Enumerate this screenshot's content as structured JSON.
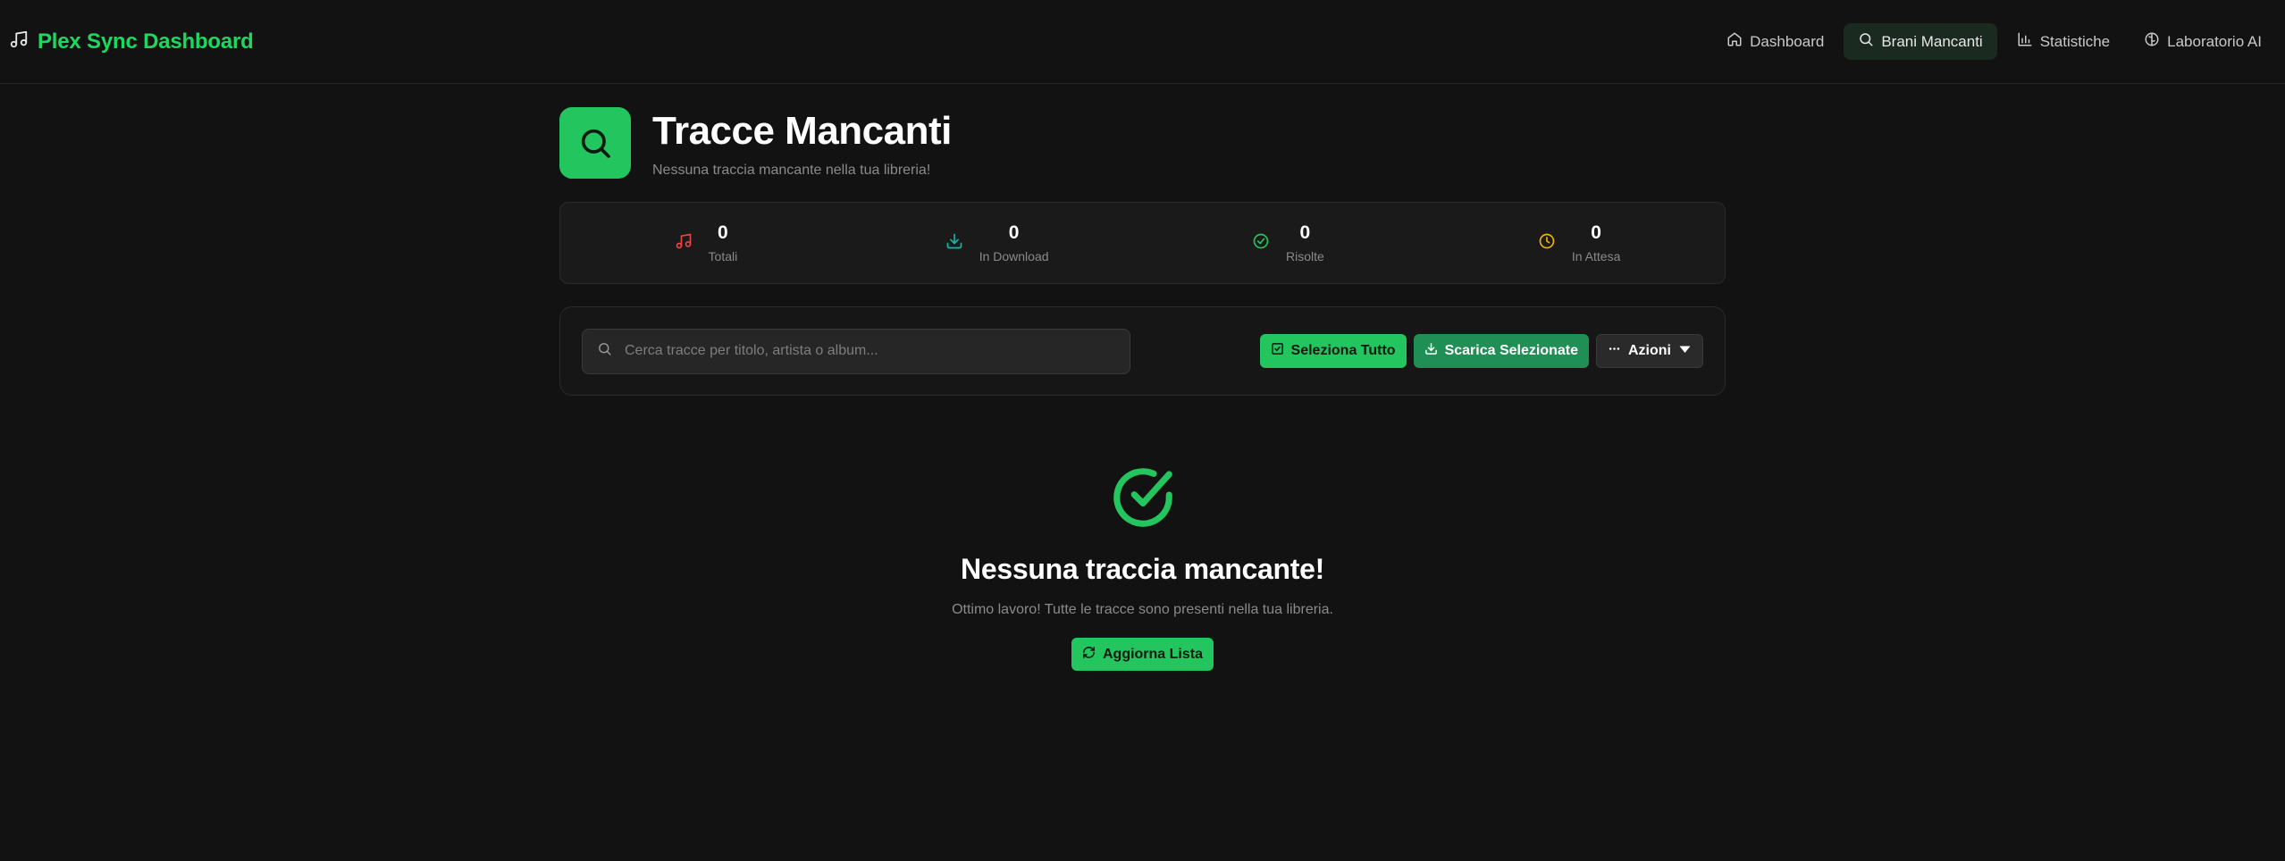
{
  "navbar": {
    "brand": "Plex Sync Dashboard",
    "items": [
      {
        "label": "Dashboard",
        "icon": "home-icon"
      },
      {
        "label": "Brani Mancanti",
        "icon": "search-icon",
        "active": true
      },
      {
        "label": "Statistiche",
        "icon": "bar-chart-icon"
      },
      {
        "label": "Laboratorio AI",
        "icon": "brain-icon"
      }
    ]
  },
  "header": {
    "title": "Tracce Mancanti",
    "subtitle": "Nessuna traccia mancante nella tua libreria!"
  },
  "stats": [
    {
      "value": "0",
      "label": "Totali",
      "icon": "music-note-icon",
      "color": "#ef4444"
    },
    {
      "value": "0",
      "label": "In Download",
      "icon": "download-icon",
      "color": "#14b8a6"
    },
    {
      "value": "0",
      "label": "Risolte",
      "icon": "check-circle-icon",
      "color": "#22c55e"
    },
    {
      "value": "0",
      "label": "In Attesa",
      "icon": "clock-icon",
      "color": "#eab308"
    }
  ],
  "toolbar": {
    "search_placeholder": "Cerca tracce per titolo, artista o album...",
    "select_all": "Seleziona Tutto",
    "download_selected": "Scarica Selezionate",
    "actions": "Azioni"
  },
  "empty_state": {
    "title": "Nessuna traccia mancante!",
    "text": "Ottimo lavoro! Tutte le tracce sono presenti nella tua libreria.",
    "refresh": "Aggiorna Lista"
  },
  "colors": {
    "accent": "#22c55e",
    "brand_text": "#1ed760",
    "background": "#121212"
  }
}
